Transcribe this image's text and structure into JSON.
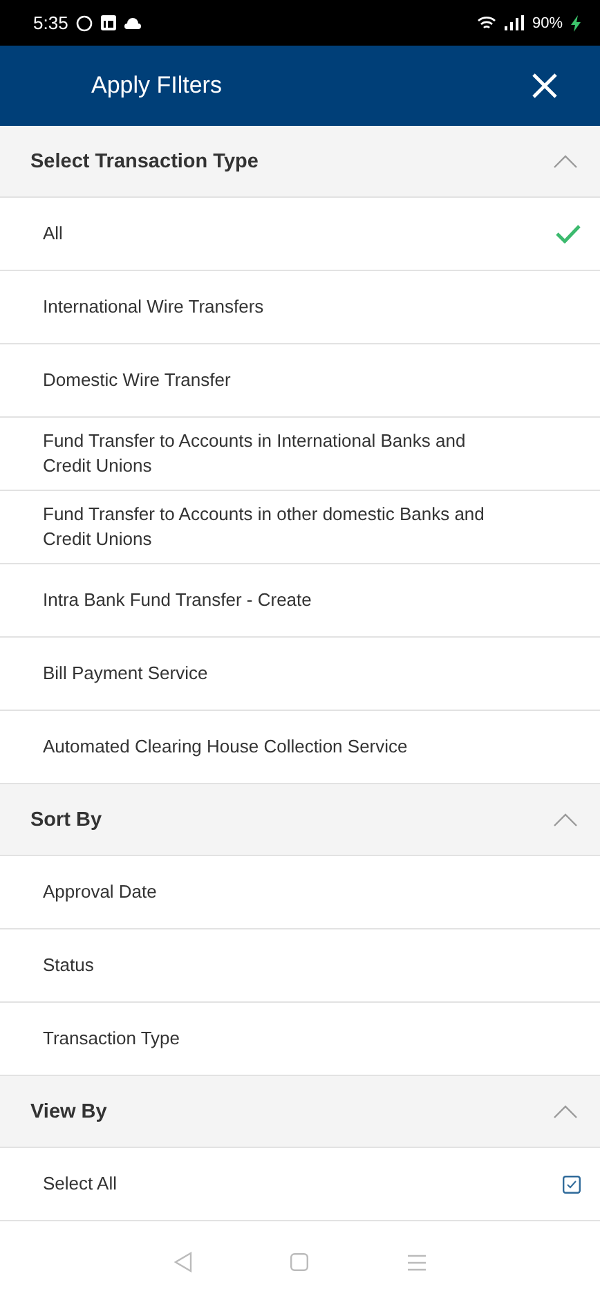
{
  "status_bar": {
    "time": "5:35",
    "battery": "90%"
  },
  "header": {
    "title": "Apply FIlters"
  },
  "sections": [
    {
      "title": "Select Transaction Type",
      "expanded": true,
      "items": [
        {
          "kind": "option",
          "label": "All",
          "selected": true
        },
        {
          "kind": "option",
          "label": "International Wire Transfers",
          "selected": false
        },
        {
          "kind": "option",
          "label": "Domestic Wire Transfer",
          "selected": false
        },
        {
          "kind": "option",
          "label": "Fund Transfer to Accounts in International Banks and Credit Unions",
          "selected": false
        },
        {
          "kind": "option",
          "label": "Fund Transfer to Accounts in other domestic Banks and Credit Unions",
          "selected": false
        },
        {
          "kind": "option",
          "label": "Intra Bank Fund Transfer - Create",
          "selected": false
        },
        {
          "kind": "option",
          "label": "Bill Payment Service",
          "selected": false
        },
        {
          "kind": "option",
          "label": "Automated Clearing House Collection Service",
          "selected": false
        }
      ]
    },
    {
      "title": "Sort By",
      "expanded": true,
      "items": [
        {
          "kind": "option",
          "label": "Approval Date",
          "selected": false
        },
        {
          "kind": "option",
          "label": "Status",
          "selected": false
        },
        {
          "kind": "option",
          "label": "Transaction Type",
          "selected": false
        }
      ]
    },
    {
      "title": "View By",
      "expanded": true,
      "items": [
        {
          "kind": "checkbox",
          "label": "Select All",
          "checked": true
        }
      ]
    }
  ]
}
